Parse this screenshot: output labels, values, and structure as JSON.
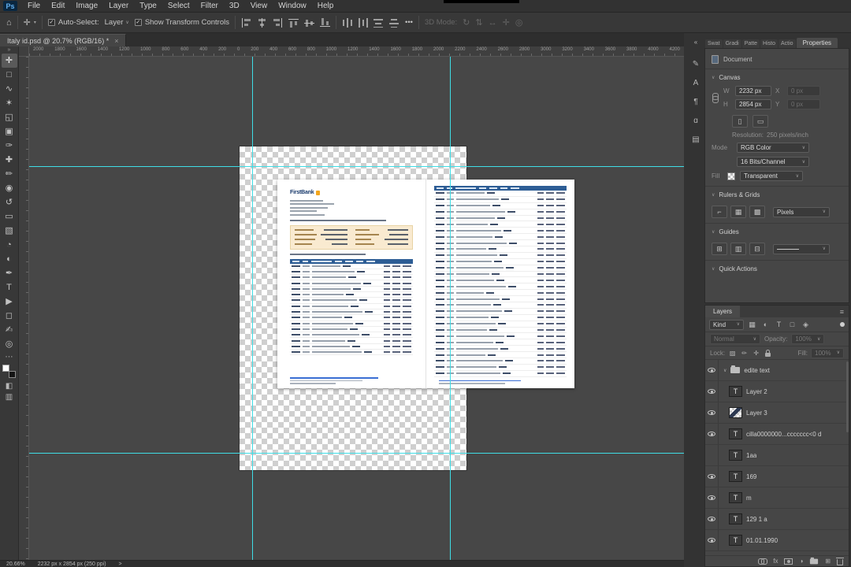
{
  "app": {
    "badge": "Ps"
  },
  "menu": {
    "items": [
      "File",
      "Edit",
      "Image",
      "Layer",
      "Type",
      "Select",
      "Filter",
      "3D",
      "View",
      "Window",
      "Help"
    ]
  },
  "options_bar": {
    "auto_select_label": "Auto-Select:",
    "auto_select_value": "Layer",
    "show_transform_label": "Show Transform Controls",
    "more_label": "•••",
    "mode_3d_label": "3D Mode:"
  },
  "document_tab": {
    "title": "Italy id.psd @ 20.7% (RGB/16) *",
    "close": "×"
  },
  "ruler": {
    "numbers": [
      "2000",
      "1800",
      "1600",
      "1400",
      "1200",
      "1000",
      "800",
      "600",
      "400",
      "200",
      "0",
      "200",
      "400",
      "600",
      "800",
      "1000",
      "1200",
      "1400",
      "1600",
      "1800",
      "2000",
      "2200",
      "2400",
      "2600",
      "2800",
      "3000",
      "3200",
      "3400",
      "3600",
      "3800",
      "4000",
      "4200"
    ]
  },
  "tools": [
    {
      "name": "move-tool",
      "glyph": "✛"
    },
    {
      "name": "marquee-tool",
      "glyph": "□"
    },
    {
      "name": "lasso-tool",
      "glyph": "∿"
    },
    {
      "name": "quick-selection-tool",
      "glyph": "✶"
    },
    {
      "name": "crop-tool",
      "glyph": "◱"
    },
    {
      "name": "frame-tool",
      "glyph": "▣"
    },
    {
      "name": "eyedropper-tool",
      "glyph": "✑"
    },
    {
      "name": "healing-brush-tool",
      "glyph": "✚"
    },
    {
      "name": "brush-tool",
      "glyph": "✏"
    },
    {
      "name": "clone-stamp-tool",
      "glyph": "◉"
    },
    {
      "name": "history-brush-tool",
      "glyph": "↺"
    },
    {
      "name": "eraser-tool",
      "glyph": "▭"
    },
    {
      "name": "gradient-tool",
      "glyph": "▧"
    },
    {
      "name": "blur-tool",
      "glyph": "◔"
    },
    {
      "name": "dodge-tool",
      "glyph": "◐"
    },
    {
      "name": "pen-tool",
      "glyph": "✒"
    },
    {
      "name": "type-tool",
      "glyph": "T"
    },
    {
      "name": "path-selection-tool",
      "glyph": "▶"
    },
    {
      "name": "shape-tool",
      "glyph": "◻"
    },
    {
      "name": "hand-tool",
      "glyph": "✍"
    },
    {
      "name": "zoom-tool",
      "glyph": "◎"
    }
  ],
  "dock_icons": [
    {
      "name": "collapse-panels-icon",
      "glyph": "«"
    },
    {
      "name": "brush-settings-panel-icon",
      "glyph": "✎"
    },
    {
      "name": "character-panel-icon",
      "glyph": "A"
    },
    {
      "name": "paragraph-panel-icon",
      "glyph": "¶"
    },
    {
      "name": "glyphs-panel-icon",
      "glyph": "ɑ"
    },
    {
      "name": "libraries-panel-icon",
      "glyph": "▤"
    }
  ],
  "panel_tabs": {
    "inactive": [
      "Swat",
      "Gradi",
      "Patte",
      "Histo",
      "Actio"
    ],
    "active": "Properties"
  },
  "properties": {
    "document_label": "Document",
    "canvas_section": "Canvas",
    "w_label": "W",
    "w_value": "2232 px",
    "h_label": "H",
    "h_value": "2854 px",
    "x_label": "X",
    "x_value": "0 px",
    "y_label": "Y",
    "y_value": "0 px",
    "resolution_label": "Resolution:",
    "resolution_value": "250 pixels/inch",
    "mode_label": "Mode",
    "mode_value": "RGB Color",
    "bit_depth": "16 Bits/Channel",
    "fill_label": "Fill",
    "fill_value": "Transparent",
    "rulers_section": "Rulers & Grids",
    "units_value": "Pixels",
    "guides_section": "Guides",
    "quick_actions_section": "Quick Actions"
  },
  "layers": {
    "tab_label": "Layers",
    "kind_label": "Kind",
    "blend_mode": "Normal",
    "opacity_label": "Opacity:",
    "opacity_value": "100%",
    "lock_label": "Lock:",
    "fill_label": "Fill:",
    "fill_value": "100%",
    "fx_label": "fx",
    "items": [
      {
        "name": "edite text",
        "type": "group",
        "visible": true
      },
      {
        "name": "Layer 2",
        "type": "text",
        "visible": true
      },
      {
        "name": "Layer 3",
        "type": "pixel",
        "visible": true
      },
      {
        "name": "cilla0000000...ccccccc<0 d",
        "type": "text",
        "visible": true
      },
      {
        "name": "1aa",
        "type": "text",
        "visible": false
      },
      {
        "name": "169",
        "type": "text",
        "visible": true
      },
      {
        "name": "m",
        "type": "text",
        "visible": true
      },
      {
        "name": "129 1 a",
        "type": "text",
        "visible": true
      },
      {
        "name": "01.01.1990",
        "type": "text",
        "visible": true
      }
    ]
  },
  "statement": {
    "logo": "FirstBank",
    "left_page_rows": 16,
    "right_page_rows": 30
  },
  "status_bar": {
    "zoom": "20.66%",
    "dimensions": "2232 px x 2854 px (250 ppi)",
    "arrow": ">"
  }
}
